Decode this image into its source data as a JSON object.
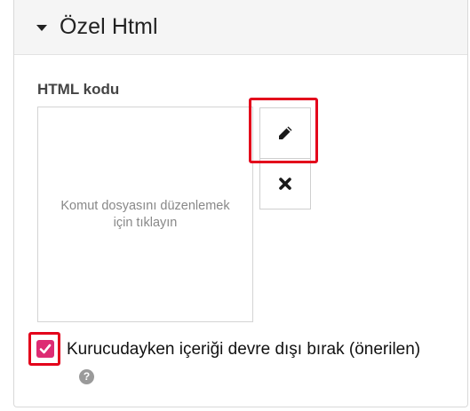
{
  "panel": {
    "title": "Özel Html",
    "caret_icon": "caret-down-icon"
  },
  "field": {
    "label": "HTML kodu",
    "placeholder_text": "Komut dosyasını düzenlemek için tıklayın"
  },
  "buttons": {
    "edit_icon": "pencil-icon",
    "clear_icon": "close-icon"
  },
  "option": {
    "checked": true,
    "label": "Kurucudayken içeriği devre dışı bırak (önerilen)",
    "help_icon": "question-icon",
    "help_glyph": "?"
  },
  "colors": {
    "checkbox_accent": "#dd2c73",
    "highlight": "#e3001b"
  }
}
